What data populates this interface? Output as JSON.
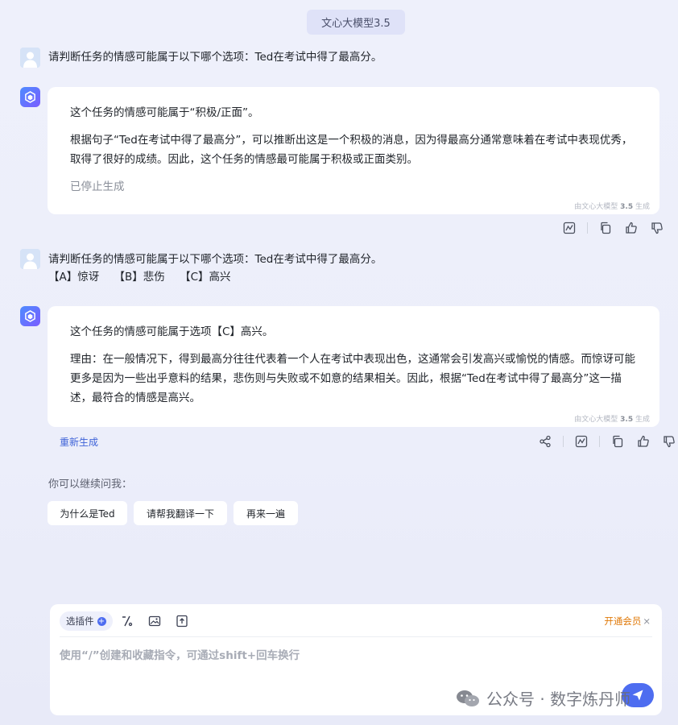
{
  "header": {
    "model_name": "文心大模型3.5"
  },
  "conversation": [
    {
      "role": "user",
      "text": "请判断任务的情感可能属于以下哪个选项：Ted在考试中得了最高分。"
    },
    {
      "role": "assistant",
      "paragraphs": [
        "这个任务的情感可能属于“积极/正面”。",
        "根据句子“Ted在考试中得了最高分”，可以推断出这是一个积极的消息，因为得最高分通常意味着在考试中表现优秀，取得了很好的成绩。因此，这个任务的情感最可能属于积极或正面类别。"
      ],
      "status": "已停止生成",
      "tag_prefix": "由文心大模型",
      "tag_version": "3.5",
      "tag_suffix": "生成"
    },
    {
      "role": "user",
      "text": "请判断任务的情感可能属于以下哪个选项：Ted在考试中得了最高分。",
      "options": [
        "【A】惊讶",
        "【B】悲伤",
        "【C】高兴"
      ]
    },
    {
      "role": "assistant",
      "paragraphs": [
        "这个任务的情感可能属于选项【C】高兴。",
        "理由：在一般情况下，得到最高分往往代表着一个人在考试中表现出色，这通常会引发高兴或愉悦的情感。而惊讶可能更多是因为一些出乎意料的结果，悲伤则与失败或不如意的结果相关。因此，根据“Ted在考试中得了最高分”这一描述，最符合的情感是高兴。"
      ],
      "tag_prefix": "由文心大模型",
      "tag_version": "3.5",
      "tag_suffix": "生成",
      "regenerate_label": "重新生成"
    }
  ],
  "suggestions": {
    "label": "你可以继续问我：",
    "items": [
      "为什么是Ted",
      "请帮我翻译一下",
      "再来一遍"
    ]
  },
  "composer": {
    "plugin_label": "选插件",
    "vip_label": "开通会员",
    "vip_close": "×",
    "placeholder": "使用“/”创建和收藏指令，可通过shift+回车换行"
  },
  "watermark": {
    "text": "公众号 · 数字炼丹师"
  },
  "icons": {
    "action_icons": [
      "chart-icon",
      "copy-icon",
      "thumbs-up-icon",
      "thumbs-down-icon"
    ],
    "share_icon": "share-icon"
  },
  "colors": {
    "accent": "#4e6df0",
    "vip": "#e07a0a",
    "link": "#3f63d8"
  }
}
